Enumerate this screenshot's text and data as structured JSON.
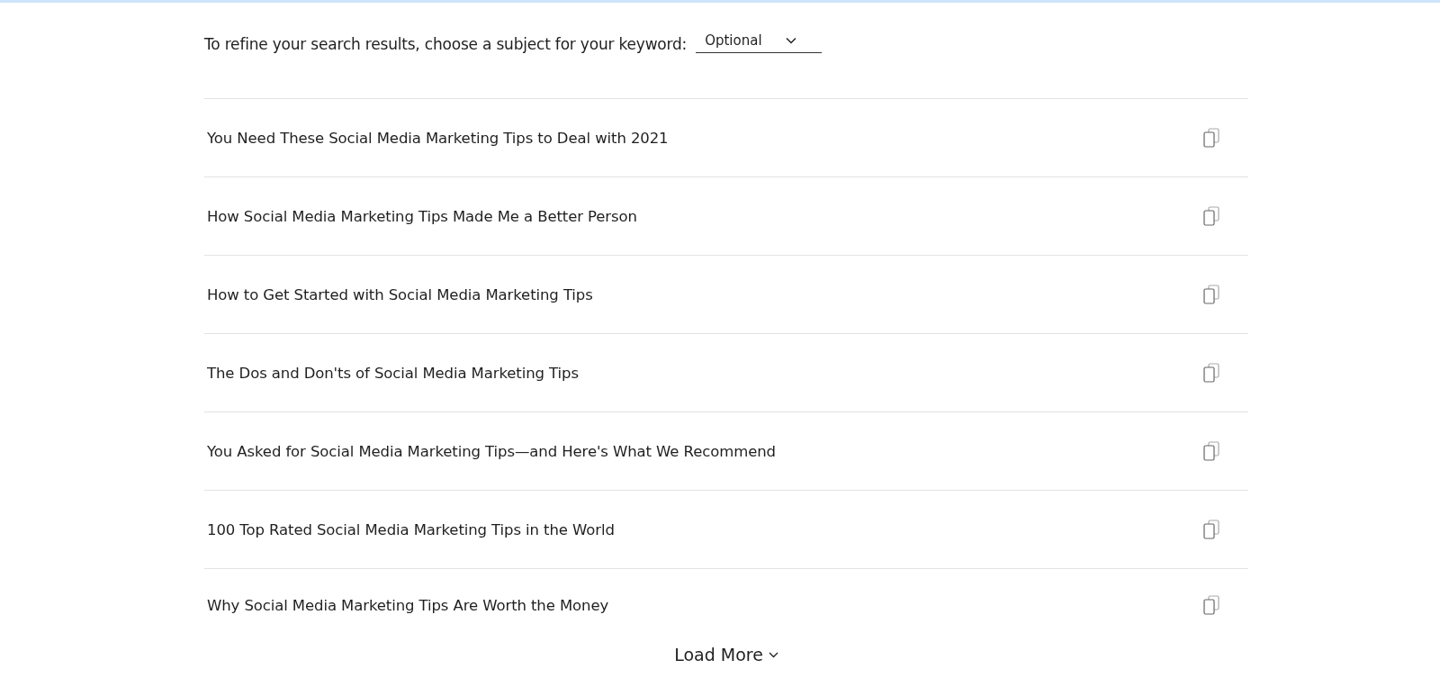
{
  "filter": {
    "label": "To refine your search results, choose a subject for your keyword:",
    "dropdown": {
      "placeholder": "Optional"
    }
  },
  "results": [
    {
      "title": "You Need These Social Media Marketing Tips to Deal with 2021"
    },
    {
      "title": "How Social Media Marketing Tips Made Me a Better Person"
    },
    {
      "title": "How to Get Started with Social Media Marketing Tips"
    },
    {
      "title": "The Dos and Don'ts of Social Media Marketing Tips"
    },
    {
      "title": "You Asked for Social Media Marketing Tips—and Here's What We Recommend"
    },
    {
      "title": "100 Top Rated Social Media Marketing Tips in the World"
    },
    {
      "title": "Why Social Media Marketing Tips Are Worth the Money"
    }
  ],
  "load_more": "Load More"
}
